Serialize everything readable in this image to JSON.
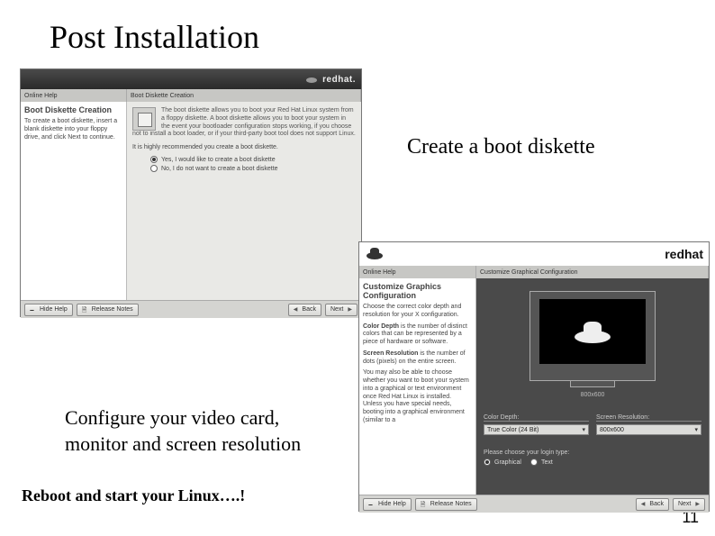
{
  "slide": {
    "title": "Post Installation",
    "caption_right": "Create a boot diskette",
    "caption_left_line1": "Configure your video card,",
    "caption_left_line2": "monitor and screen resolution",
    "caption_bottom": "Reboot and start your Linux….!",
    "page_number": "11"
  },
  "shot1": {
    "brand": "redhat.",
    "subhead_left": "Online Help",
    "subhead_right": "Boot Diskette Creation",
    "help_title": "Boot Diskette Creation",
    "help_body": "To create a boot diskette, insert a blank diskette into your floppy drive, and click Next to continue.",
    "desc1": "The boot diskette allows you to boot your Red Hat Linux system from a floppy diskette. A boot diskette allows you to boot your system in the event your bootloader configuration stops working, if you choose not to install a boot loader, or if your third-party boot tool does not support Linux.",
    "desc2": "It is highly recommended you create a boot diskette.",
    "radio_yes": "Yes, I would like to create a boot diskette",
    "radio_no": "No, I do not want to create a boot diskette",
    "btn_hide": "Hide Help",
    "btn_notes": "Release Notes",
    "btn_back": "Back",
    "btn_next": "Next"
  },
  "shot2": {
    "brand": "redhat",
    "subhead_left": "Online Help",
    "subhead_right": "Customize Graphical Configuration",
    "help_title": "Customize Graphics Configuration",
    "help_p1": "Choose the correct color depth and resolution for your X configuration.",
    "help_p2a": "Color Depth",
    "help_p2b": " is the number of distinct colors that can be represented by a piece of hardware or software.",
    "help_p3a": "Screen Resolution",
    "help_p3b": " is the number of dots (pixels) on the entire screen.",
    "help_p4": "You may also be able to choose whether you want to boot your system into a graphical or text environment once Red Hat Linux is installed. Unless you have special needs, booting into a graphical environment (similar to a",
    "resolution_current": "800x600",
    "color_depth_label": "Color Depth:",
    "color_depth_value": "True Color (24 Bit)",
    "screen_res_label": "Screen Resolution:",
    "screen_res_value": "800x600",
    "login_prompt": "Please choose your login type:",
    "login_graphical": "Graphical",
    "login_text": "Text",
    "btn_hide": "Hide Help",
    "btn_notes": "Release Notes",
    "btn_back": "Back",
    "btn_next": "Next"
  }
}
